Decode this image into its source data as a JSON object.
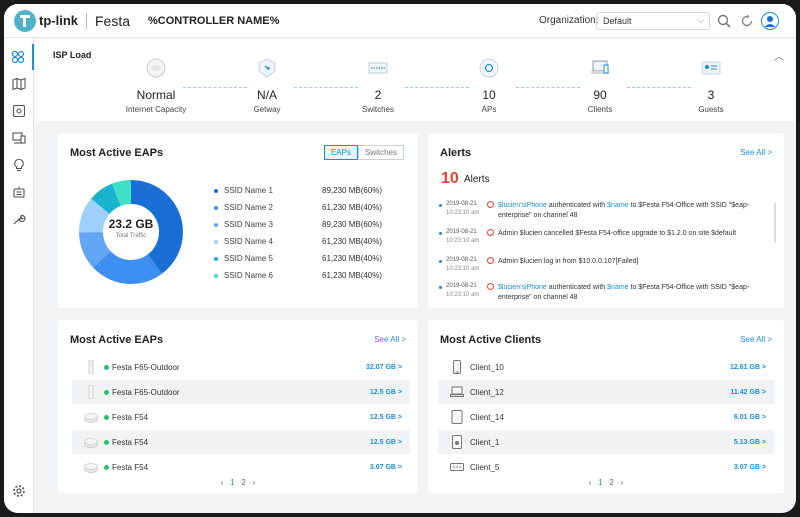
{
  "header": {
    "logo_text": "tp-link",
    "brand": "Festa",
    "controller_name": "%CONTROLLER NAME%",
    "org_label": "Organization:",
    "org_value": "Default"
  },
  "isp": {
    "title": "ISP Load",
    "nodes": [
      {
        "value": "Normal",
        "label": "Internet Capacity"
      },
      {
        "value": "N/A",
        "label": "Getway"
      },
      {
        "value": "2",
        "label": "Switches"
      },
      {
        "value": "10",
        "label": "APs"
      },
      {
        "value": "90",
        "label": "Clients"
      },
      {
        "value": "3",
        "label": "Guests"
      }
    ]
  },
  "eaps_chart": {
    "title": "Most Active EAPs",
    "tabs": [
      "EAPs",
      "Switches"
    ],
    "total_value": "23.2 GB",
    "total_label": "Total Traffic",
    "legend": [
      {
        "name": "SSID Name 1",
        "value": "89,230 MB(60%)",
        "color": "#1a6fd6"
      },
      {
        "name": "SSID Name 2",
        "value": "61,230 MB(40%)",
        "color": "#3d8ff0"
      },
      {
        "name": "SSID Name 3",
        "value": "89,230 MB(60%)",
        "color": "#62a6f5"
      },
      {
        "name": "SSID Name 4",
        "value": "61,230 MB(40%)",
        "color": "#9fd0fa"
      },
      {
        "name": "SSID Name 5",
        "value": "61,230 MB(40%)",
        "color": "#19b3cf"
      },
      {
        "name": "SSID Name 6",
        "value": "61,230 MB(40%)",
        "color": "#3fe0c5"
      }
    ]
  },
  "alerts": {
    "title": "Alerts",
    "see_all": "See All >",
    "count": "10",
    "count_label": "Alerts",
    "items": [
      {
        "date": "2019-08-21",
        "time": "10:23:10 am",
        "parts": [
          "$lucien'siPhone",
          " authenticated with ",
          "$name",
          " to $Festa F54-Office with SSID \"$eap-enterprise\" on channel 48"
        ]
      },
      {
        "date": "2019-08-21",
        "time": "10:23:10 am",
        "parts": [
          "",
          "Admin $lucien cancelled $Festa F54-office upgrade to $1.2.0 on site $default",
          "",
          ""
        ]
      },
      {
        "date": "2019-08-21",
        "time": "10:23:10 am",
        "parts": [
          "",
          "Admin $lucien log in from $10.0.0.107[Failed]",
          "",
          ""
        ]
      },
      {
        "date": "2019-08-21",
        "time": "10:23:10 am",
        "parts": [
          "$lucien'siPhone",
          " authenticated with ",
          "$name",
          " to $Festa F54-Office with SSID \"$eap-enterprise\" on channel 48"
        ]
      }
    ]
  },
  "eap_list": {
    "title": "Most Active EAPs",
    "see_all": "See All >",
    "rows": [
      {
        "name": "Festa F65-Outdoor",
        "value": "32.07 GB >",
        "icon": "outdoor-ap-icon"
      },
      {
        "name": "Festa F65-Outdoor",
        "value": "12.5 GB >",
        "icon": "outdoor-ap-icon"
      },
      {
        "name": "Festa F54",
        "value": "12.5 GB >",
        "icon": "ceiling-ap-icon"
      },
      {
        "name": "Festa F54",
        "value": "12.5 GB >",
        "icon": "ceiling-ap-icon"
      },
      {
        "name": "Festa F54",
        "value": "3.07 GB >",
        "icon": "ceiling-ap-icon"
      }
    ],
    "pager": {
      "prev": "‹",
      "pages": [
        "1",
        "2"
      ],
      "next": "›"
    }
  },
  "client_list": {
    "title": "Most Active Clients",
    "see_all": "See All >",
    "rows": [
      {
        "name": "Client_10",
        "value": "12.61 GB >",
        "icon": "phone-icon"
      },
      {
        "name": "Client_12",
        "value": "11.42 GB >",
        "icon": "laptop-icon"
      },
      {
        "name": "Client_14",
        "value": "6.01 GB >",
        "icon": "tablet-icon"
      },
      {
        "name": "Client_1",
        "value": "5.13 GB >",
        "icon": "speaker-icon"
      },
      {
        "name": "Client_5",
        "value": "3.07 GB >",
        "icon": "set-top-box-icon"
      }
    ],
    "pager": {
      "prev": "‹",
      "pages": [
        "1",
        "2"
      ],
      "next": "›"
    }
  }
}
